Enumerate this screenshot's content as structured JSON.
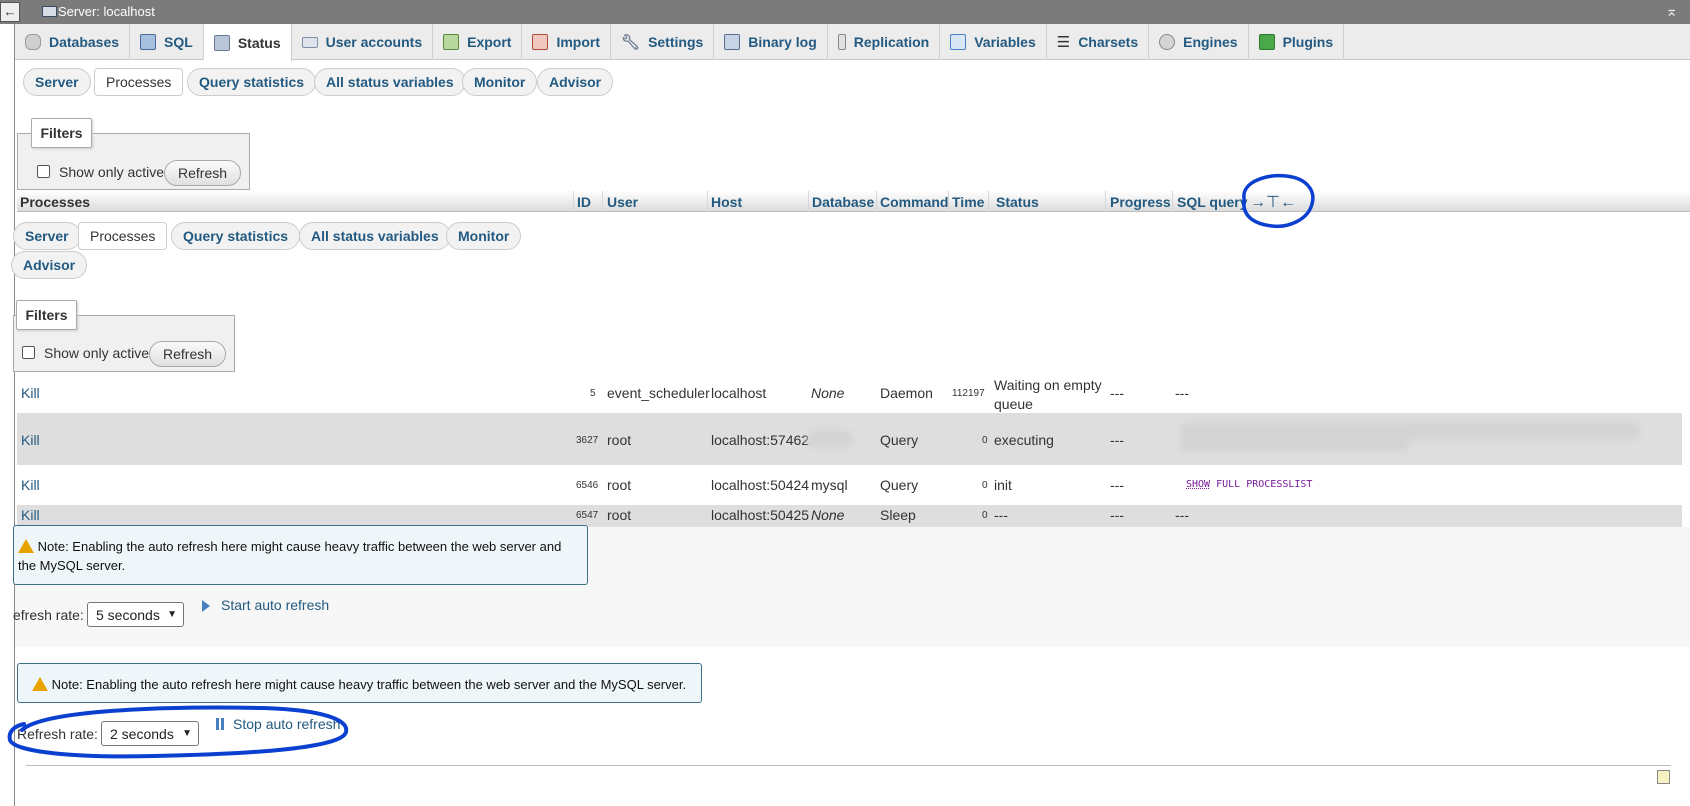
{
  "window": {
    "title": "Server: localhost",
    "back": "←",
    "collapse": "⌅"
  },
  "tabs": [
    {
      "label": "Databases",
      "icon": "database-icon",
      "color": "#c9c9c9"
    },
    {
      "label": "SQL",
      "icon": "sql-icon",
      "color": "#7fa0c8"
    },
    {
      "label": "Status",
      "icon": "status-icon",
      "color": "#8aa0bb"
    },
    {
      "label": "User accounts",
      "icon": "users-icon",
      "color": "#9aa7b8"
    },
    {
      "label": "Export",
      "icon": "export-icon",
      "color": "#6b9b4a"
    },
    {
      "label": "Import",
      "icon": "import-icon",
      "color": "#c25a4a"
    },
    {
      "label": "Settings",
      "icon": "wrench-icon",
      "color": "#8a9ab0"
    },
    {
      "label": "Binary log",
      "icon": "binary-log-icon",
      "color": "#7f95b5"
    },
    {
      "label": "Replication",
      "icon": "replication-icon",
      "color": "#a0a0a0"
    },
    {
      "label": "Variables",
      "icon": "variables-icon",
      "color": "#4a7fc0"
    },
    {
      "label": "Charsets",
      "icon": "charsets-icon",
      "color": "#444444"
    },
    {
      "label": "Engines",
      "icon": "engines-icon",
      "color": "#999999"
    },
    {
      "label": "Plugins",
      "icon": "plugins-icon",
      "color": "#3a9a3a"
    }
  ],
  "subnav": {
    "server": "Server",
    "processes": "Processes",
    "query_statistics": "Query statistics",
    "all_status_variables": "All status variables",
    "monitor": "Monitor",
    "advisor": "Advisor"
  },
  "filters": {
    "legend": "Filters",
    "show_only_active": "Show only active",
    "refresh": "Refresh"
  },
  "headers": {
    "processes": "Processes",
    "id": "ID",
    "user": "User",
    "host": "Host",
    "database": "Database",
    "command": "Command",
    "time": "Time",
    "status": "Status",
    "progress": "Progress",
    "sql_query": "SQL query",
    "toggle": "→⊤←"
  },
  "rows": [
    {
      "kill": "Kill",
      "id": "5",
      "user": "event_scheduler",
      "host": "localhost",
      "database": "None",
      "command": "Daemon",
      "time": "112197",
      "status": "Waiting on empty queue",
      "progress": "---",
      "sql": "---"
    },
    {
      "kill": "Kill",
      "id": "3627",
      "user": "root",
      "host": "localhost:57462",
      "database": "",
      "command": "Query",
      "time": "0",
      "status": "executing",
      "progress": "---",
      "sql": ""
    },
    {
      "kill": "Kill",
      "id": "6546",
      "user": "root",
      "host": "localhost:50424",
      "database": "mysql",
      "command": "Query",
      "time": "0",
      "status": "init",
      "progress": "---",
      "sql_kw": "SHOW",
      "sql": "FULL PROCESSLIST"
    },
    {
      "kill": "Kill",
      "id": "6547",
      "user": "root",
      "host": "localhost:50425",
      "database": "None",
      "command": "Sleep",
      "time": "0",
      "status": "---",
      "progress": "---",
      "sql": "---"
    }
  ],
  "note": {
    "text": "Note: Enabling the auto refresh here might cause heavy traffic between the web server and the MySQL server."
  },
  "refresh_inner": {
    "label": "efresh rate:",
    "value": "5 seconds",
    "action": "Start auto refresh"
  },
  "refresh_outer": {
    "label": "Refresh rate:",
    "value": "2 seconds",
    "action": "Stop auto refresh"
  }
}
